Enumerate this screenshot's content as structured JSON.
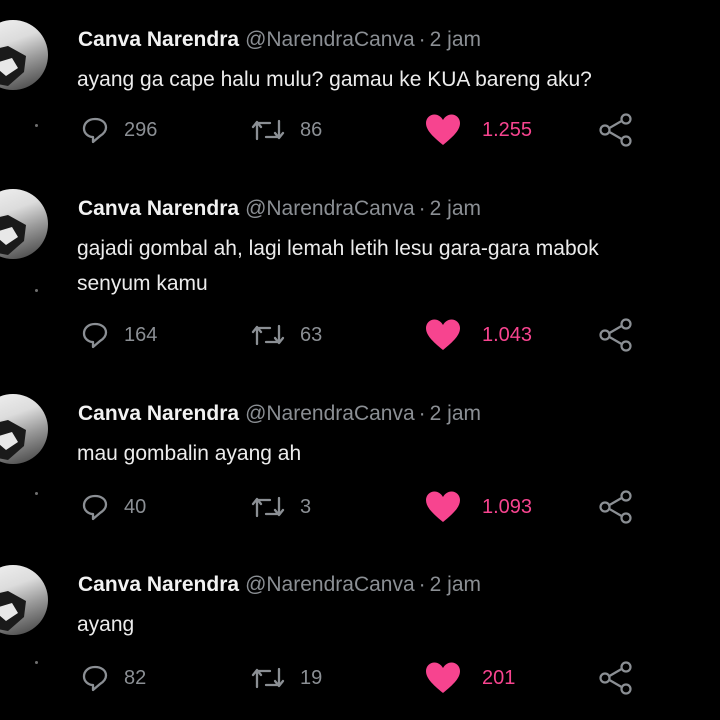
{
  "tweets": [
    {
      "name": "Canva Narendra",
      "handle": "@NarendraCanva",
      "time": "2 jam",
      "lines": [
        "ayang ga cape halu mulu? gamau ke KUA bareng aku?"
      ],
      "replies": "296",
      "retweets": "86",
      "likes": "1.255"
    },
    {
      "name": "Canva Narendra",
      "handle": "@NarendraCanva",
      "time": "2 jam",
      "lines": [
        "gajadi gombal ah, lagi lemah letih lesu gara-gara mabok",
        "senyum kamu"
      ],
      "replies": "164",
      "retweets": "63",
      "likes": "1.043"
    },
    {
      "name": "Canva Narendra",
      "handle": "@NarendraCanva",
      "time": "2 jam",
      "lines": [
        "mau gombalin ayang ah"
      ],
      "replies": "40",
      "retweets": "3",
      "likes": "1.093"
    },
    {
      "name": "Canva Narendra",
      "handle": "@NarendraCanva",
      "time": "2 jam",
      "lines": [
        "ayang"
      ],
      "replies": "82",
      "retweets": "19",
      "likes": "201"
    }
  ],
  "separator": "·",
  "icons": {
    "reply": "reply-icon",
    "retweet": "retweet-icon",
    "like": "heart-icon",
    "share": "share-icon",
    "avatar": "avatar"
  },
  "colors": {
    "background": "#000000",
    "like": "#f7448f",
    "muted": "#8b8f94",
    "text": "#ececec"
  }
}
